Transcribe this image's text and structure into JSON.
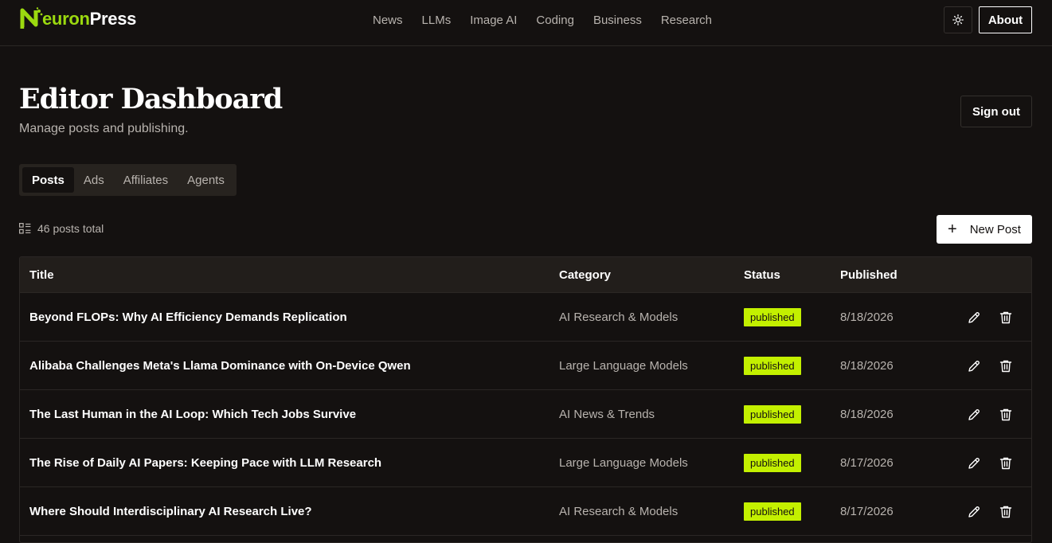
{
  "brand": {
    "logo_accent": "N",
    "logo_mid": "euron",
    "logo_rest": "Press",
    "accent_color": "#9bd90f"
  },
  "nav": {
    "items": [
      "News",
      "LLMs",
      "Image AI",
      "Coding",
      "Business",
      "Research"
    ]
  },
  "header": {
    "about_label": "About",
    "theme_icon": "sun-icon"
  },
  "page": {
    "title": "Editor Dashboard",
    "subtitle": "Manage posts and publishing.",
    "signout_label": "Sign out"
  },
  "tabs": [
    {
      "label": "Posts",
      "active": true
    },
    {
      "label": "Ads",
      "active": false
    },
    {
      "label": "Affiliates",
      "active": false
    },
    {
      "label": "Agents",
      "active": false
    }
  ],
  "posts_summary": {
    "count_text": "46 posts total",
    "new_post_label": "New Post"
  },
  "table": {
    "columns": [
      "Title",
      "Category",
      "Status",
      "Published"
    ],
    "rows": [
      {
        "title": "Beyond FLOPs: Why AI Efficiency Demands Replication",
        "category": "AI Research & Models",
        "status": "published",
        "published": "8/18/2026"
      },
      {
        "title": "Alibaba Challenges Meta's Llama Dominance with On-Device Qwen",
        "category": "Large Language Models",
        "status": "published",
        "published": "8/18/2026"
      },
      {
        "title": "The Last Human in the AI Loop: Which Tech Jobs Survive",
        "category": "AI News & Trends",
        "status": "published",
        "published": "8/18/2026"
      },
      {
        "title": "The Rise of Daily AI Papers: Keeping Pace with LLM Research",
        "category": "Large Language Models",
        "status": "published",
        "published": "8/17/2026"
      },
      {
        "title": "Where Should Interdisciplinary AI Research Live?",
        "category": "AI Research & Models",
        "status": "published",
        "published": "8/17/2026"
      }
    ]
  },
  "colors": {
    "background": "#141110",
    "status_published": "#c3f000",
    "muted_text": "#b8b3ae"
  }
}
